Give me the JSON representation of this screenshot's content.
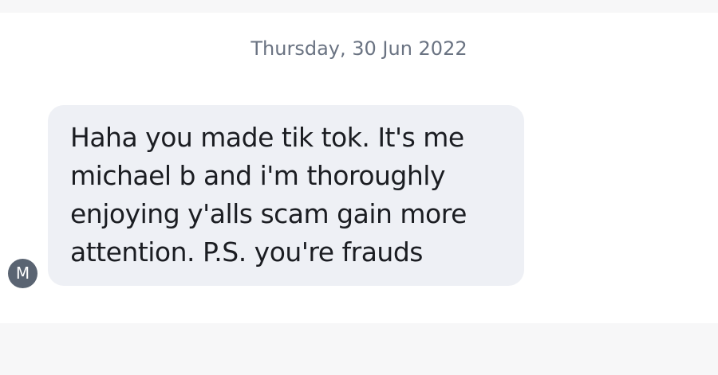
{
  "conversation": {
    "date_label": "Thursday, 30 Jun 2022",
    "messages": [
      {
        "sender_initial": "M",
        "text": "Haha you made tik tok.  It's me\nmichael b and i'm thoroughly\nenjoying y'alls scam gain more\nattention. P.S.  you're frauds"
      }
    ]
  },
  "colors": {
    "bubble_background": "#eef0f5",
    "avatar_background": "#5a6472",
    "date_text": "#6a7382",
    "message_text": "#1b1d22"
  }
}
